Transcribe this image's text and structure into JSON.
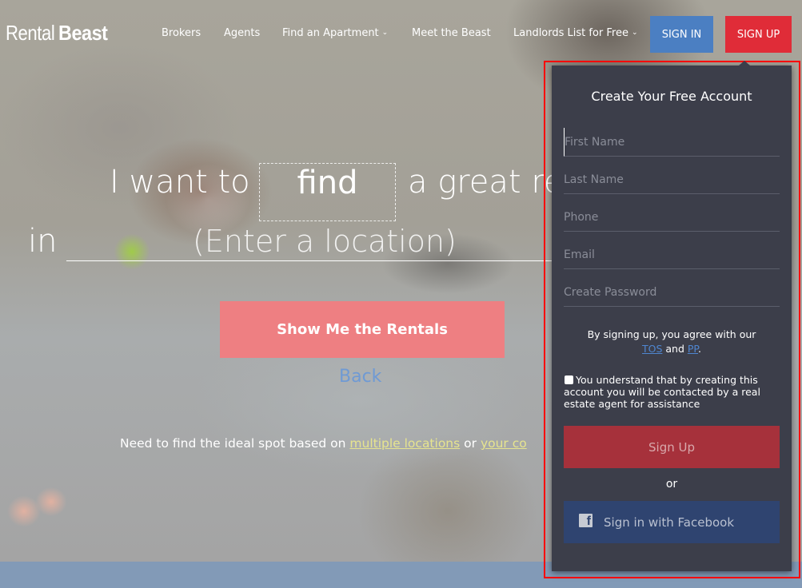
{
  "brand": {
    "logo_light": "Rental",
    "logo_bold": "Beast"
  },
  "nav": {
    "items": [
      {
        "label": "Brokers",
        "has_dropdown": false
      },
      {
        "label": "Agents",
        "has_dropdown": false
      },
      {
        "label": "Find an Apartment",
        "has_dropdown": true
      },
      {
        "label": "Meet the Beast",
        "has_dropdown": false
      },
      {
        "label": "Landlords List for Free",
        "has_dropdown": true
      }
    ],
    "dropdown_glyph": "⌄",
    "sign_in_label": "SIGN IN",
    "sign_up_label": "SIGN UP"
  },
  "hero": {
    "prefix": "I want to",
    "verb": "find",
    "suffix": "a great re",
    "in_label": "in",
    "location_placeholder": "(Enter a location)",
    "location_value": "",
    "show_button_label": "Show Me the Rentals",
    "back_label": "Back",
    "footnote_text": "Need to find the ideal spot based on ",
    "footnote_link1": "multiple locations",
    "footnote_or": " or ",
    "footnote_link2": "your co"
  },
  "signup_panel": {
    "title": "Create Your Free Account",
    "fields": [
      {
        "name": "first-name",
        "placeholder": "First Name",
        "value": ""
      },
      {
        "name": "last-name",
        "placeholder": "Last Name",
        "value": ""
      },
      {
        "name": "phone",
        "placeholder": "Phone",
        "value": ""
      },
      {
        "name": "email",
        "placeholder": "Email",
        "value": ""
      },
      {
        "name": "password",
        "placeholder": "Create Password",
        "value": ""
      }
    ],
    "agree_text": "By signing up, you agree with our",
    "tos_label": "TOS",
    "and_text": " and ",
    "pp_label": "PP",
    "period": ".",
    "consent_text": "You understand that by creating this account you will be contacted by a real estate agent for assistance",
    "consent_checked": false,
    "submit_label": "Sign Up",
    "or_label": "or",
    "facebook_label": "Sign in with Facebook",
    "facebook_icon": "f"
  },
  "colors": {
    "sign_in_blue": "#4b7fc2",
    "sign_up_red": "#e02c38",
    "show_button": "#ee7f82",
    "panel_bg": "#3c3e4a",
    "submit_red": "#a6313b",
    "facebook_blue": "#2f4470",
    "link_yellow": "#e6e48f",
    "highlight_outline": "#ff0000"
  }
}
